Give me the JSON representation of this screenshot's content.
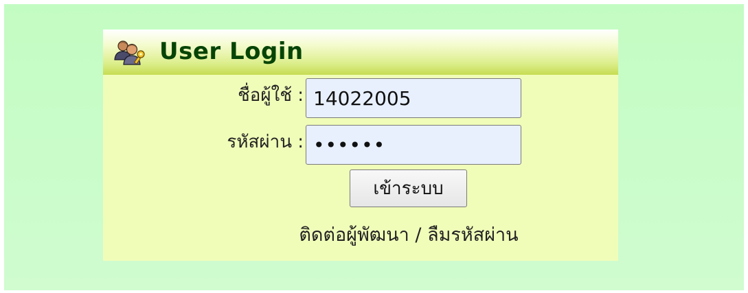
{
  "header": {
    "title": "User Login",
    "icon": "users-key-icon"
  },
  "form": {
    "username_label": "ชื่อผู้ใช้ :",
    "username_value": "14022005",
    "password_label": "รหัสผ่าน :",
    "password_value": "••••••",
    "submit_label": "เข้าระบบ"
  },
  "links": {
    "contact_developer": "ติดต่อผู้พัฒนา",
    "separator": " / ",
    "forgot_password": "ลืมรหัสผ่าน"
  },
  "colors": {
    "page_background": "#c6fcc6",
    "panel_background": "#f0fdb9",
    "title_color": "#064406",
    "input_background": "#e8f0fe"
  }
}
